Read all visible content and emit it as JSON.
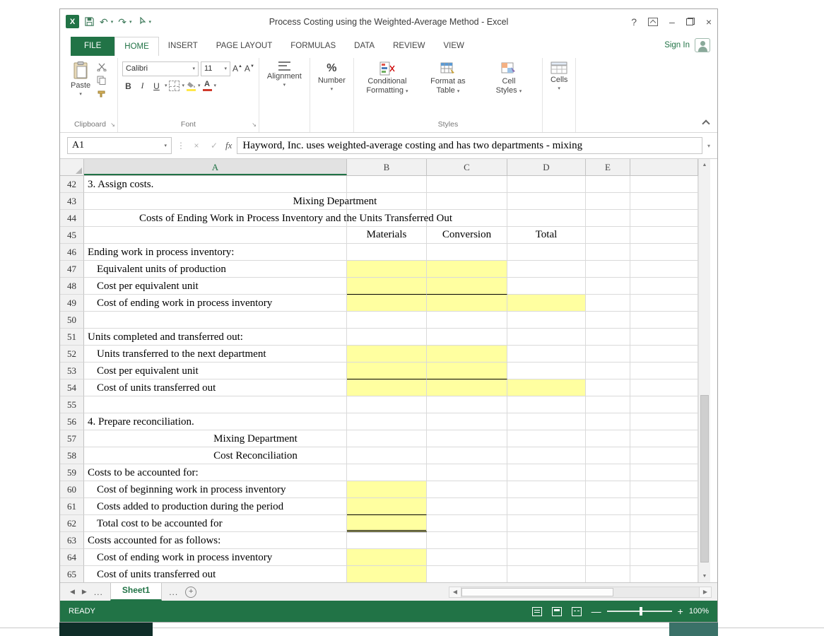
{
  "window": {
    "title": "Process Costing using the Weighted-Average Method - Excel",
    "controls": {
      "help": "?",
      "minimize": "–",
      "close": "×"
    }
  },
  "icons": {
    "caret": "▾",
    "undo": "↶",
    "redo": "↷",
    "launcher": "↘",
    "dots": "⋮",
    "check": "✓",
    "cross": "×",
    "up": "▲",
    "down": "▼",
    "left": "◀",
    "right": "▶",
    "logo_letter": "X"
  },
  "ribbon": {
    "file_tab": "FILE",
    "tabs": [
      "HOME",
      "INSERT",
      "PAGE LAYOUT",
      "FORMULAS",
      "DATA",
      "REVIEW",
      "VIEW"
    ],
    "sign_in": "Sign In",
    "clipboard": {
      "label": "Clipboard",
      "paste": "Paste"
    },
    "font": {
      "label": "Font",
      "name": "Calibri",
      "size": "11",
      "bold": "B",
      "italic": "I",
      "underline": "U",
      "grow": "A",
      "shrink": "A",
      "color_letter": "A"
    },
    "alignment": {
      "label": "Alignment"
    },
    "number": {
      "label": "Number",
      "percent": "%"
    },
    "styles": {
      "label": "Styles",
      "conditional_line1": "Conditional",
      "conditional_line2": "Formatting",
      "format_table_line1": "Format as",
      "format_table_line2": "Table",
      "cell_styles_line1": "Cell",
      "cell_styles_line2": "Styles"
    },
    "cells": {
      "label": "Cells"
    }
  },
  "formula_bar": {
    "cell_ref": "A1",
    "fx": "fx",
    "formula": "Hayword, Inc. uses weighted-average costing and has two departments - mixing"
  },
  "sheet": {
    "columns": [
      "A",
      "B",
      "C",
      "D",
      "E"
    ],
    "selected_column": "A",
    "highlight_color": "#ffffa0",
    "rows": [
      {
        "n": 42,
        "text": "3. Assign costs.",
        "align": "left"
      },
      {
        "n": 43,
        "text": "Mixing Department",
        "align": "center",
        "span": "abcd"
      },
      {
        "n": 44,
        "text": "Costs of Ending Work in Process Inventory and the Units Transferred Out",
        "align": "center",
        "span": "abc"
      },
      {
        "n": 45,
        "b": "Materials",
        "c": "Conversion",
        "d": "Total"
      },
      {
        "n": 46,
        "text": "Ending work in process inventory:",
        "align": "left"
      },
      {
        "n": 47,
        "text": "Equivalent units of production",
        "align": "indent",
        "hl": "bc"
      },
      {
        "n": 48,
        "text": "Cost per equivalent unit",
        "align": "indent",
        "hl": "bc",
        "border": "single"
      },
      {
        "n": 49,
        "text": "Cost of ending work in process inventory",
        "align": "indent",
        "hl": "bcd"
      },
      {
        "n": 50
      },
      {
        "n": 51,
        "text": "Units completed and transferred out:",
        "align": "left"
      },
      {
        "n": 52,
        "text": "Units transferred to the next department",
        "align": "indent",
        "hl": "bc"
      },
      {
        "n": 53,
        "text": "Cost per equivalent unit",
        "align": "indent",
        "hl": "bc",
        "border": "single"
      },
      {
        "n": 54,
        "text": "Cost of units transferred out",
        "align": "indent",
        "hl": "bcd"
      },
      {
        "n": 55
      },
      {
        "n": 56,
        "text": "4. Prepare reconciliation.",
        "align": "left"
      },
      {
        "n": 57,
        "text": "Mixing Department",
        "align": "center",
        "span": "ab"
      },
      {
        "n": 58,
        "text": "Cost Reconciliation",
        "align": "center",
        "span": "ab"
      },
      {
        "n": 59,
        "text": "Costs to be accounted for:",
        "align": "left"
      },
      {
        "n": 60,
        "text": "Cost of beginning work in process inventory",
        "align": "indent",
        "hl": "b"
      },
      {
        "n": 61,
        "text": "Costs added to production during the period",
        "align": "indent",
        "hl": "b",
        "border": "single"
      },
      {
        "n": 62,
        "text": "Total cost to be accounted for",
        "align": "indent",
        "hl": "b",
        "border": "double"
      },
      {
        "n": 63,
        "text": "Costs accounted for as follows:",
        "align": "left"
      },
      {
        "n": 64,
        "text": "Cost of ending work in process inventory",
        "align": "indent",
        "hl": "b"
      },
      {
        "n": 65,
        "text": "Cost of units transferred out",
        "align": "indent",
        "hl": "b"
      }
    ]
  },
  "tab_bar": {
    "sheet": "Sheet1",
    "dots": "...",
    "add": "+"
  },
  "status_bar": {
    "mode": "READY",
    "zoom": "100%"
  }
}
